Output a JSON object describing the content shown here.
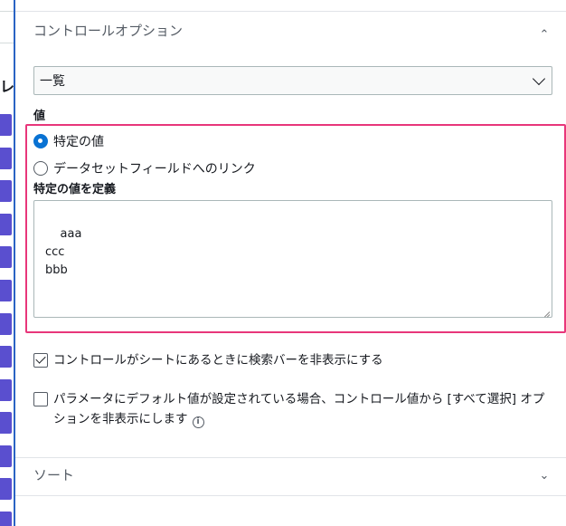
{
  "left_strip": {
    "glyph": "レ"
  },
  "control_options": {
    "header": "コントロールオプション",
    "select_value": "一覧"
  },
  "values": {
    "label": "値",
    "radio_specific": "特定の値",
    "radio_dataset": "データセットフィールドへのリンク",
    "define_label": "特定の値を定義",
    "textarea_value": "aaa\nccc\nbbb"
  },
  "options": {
    "hide_search": "コントロールがシートにあるときに検索バーを非表示にする",
    "hide_select_all": "パラメータにデフォルト値が設定されている場合、コントロール値から [すべて選択] オプションを非表示にします"
  },
  "sort": {
    "header": "ソート"
  },
  "colors": {
    "highlight": "#e8367a",
    "accent": "#0972d3",
    "left_edge": "#2a64c4",
    "side_button": "#5a4fcf"
  }
}
